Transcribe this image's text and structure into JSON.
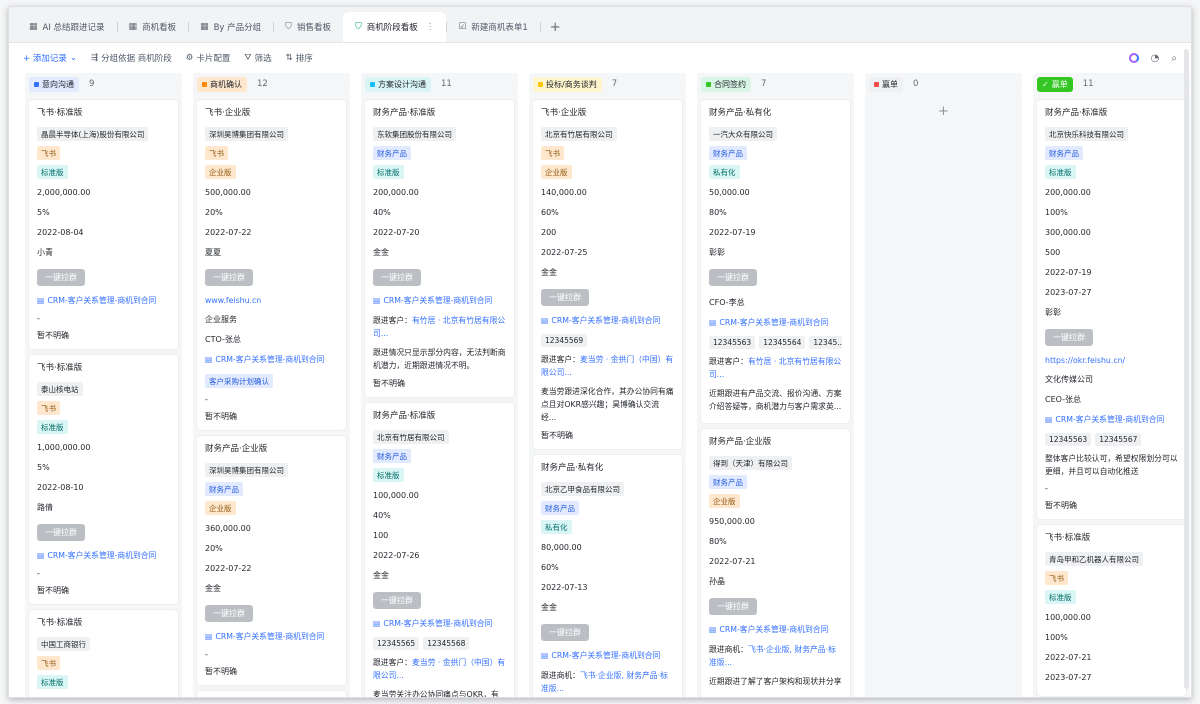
{
  "tabs": [
    {
      "icon": "▦",
      "label": "AI 总结跟进记录"
    },
    {
      "icon": "▦",
      "label": "商机看板"
    },
    {
      "icon": "▦",
      "label": "By 产品分组"
    },
    {
      "icon": "⛉",
      "label": "销售看板"
    },
    {
      "icon": "⛉",
      "label": "商机阶段看板",
      "more": "⋮"
    },
    {
      "icon": "☑",
      "label": "新建商机表单1"
    }
  ],
  "tab_add": "+",
  "toolbar": {
    "add_record": "+ 添加记录",
    "add_caret": "⌄",
    "group_by": "分组依据 商机阶段",
    "card_config": "卡片配置",
    "filter": "筛选",
    "sort": "排序"
  },
  "colors": {
    "accent": "#3370ff",
    "active_tab_icon": "#00a870"
  },
  "columns": [
    {
      "stage": "意向沟通",
      "stage_bg": "#e1eaff",
      "stage_sq": "#3370ff",
      "count": "9",
      "cards": [
        {
          "title": "飞书·标准版",
          "company": "晶晨半导体(上海)股份有限公司",
          "tag1": "飞书",
          "tag2": "标准版",
          "amount": "2,000,000.00",
          "pct": "5%",
          "date": "2022-08-04",
          "owner": "小青",
          "btn": "一键拉群",
          "link": "CRM-客户关系管理-商机到合同",
          "dash": "-",
          "status": "暂不明确"
        },
        {
          "title": "飞书·标准版",
          "company": "泰山核电站",
          "tag1": "飞书",
          "tag2": "标准版",
          "amount": "1,000,000.00",
          "pct": "5%",
          "date": "2022-08-10",
          "owner": "路倩",
          "btn": "一键拉群",
          "link": "CRM-客户关系管理-商机到合同",
          "dash": "-",
          "status": "暂不明确"
        },
        {
          "title": "飞书·标准版",
          "company": "中国工商银行",
          "tag1": "飞书",
          "tag2": "标准版",
          "amount": "1,000,000.00"
        }
      ]
    },
    {
      "stage": "商机确认",
      "stage_bg": "#fee7cd",
      "stage_sq": "#ff8800",
      "count": "12",
      "cards": [
        {
          "title": "飞书·企业版",
          "company": "深圳昊博集团有限公司",
          "tag1": "飞书",
          "tag2": "企业版",
          "amount": "500,000.00",
          "pct": "20%",
          "date": "2022-07-22",
          "owner": "夏夏",
          "btn": "一键拉群",
          "site": "www.feishu.cn",
          "industry": "企业服务",
          "contact": "CTO-张总",
          "link": "CRM-客户关系管理-商机到合同",
          "tag3": "客户采购计划确认",
          "dash": "-",
          "status": "暂不明确"
        },
        {
          "title": "财务产品·企业版",
          "company": "深圳昊博集团有限公司",
          "tag1": "财务产品",
          "tag2": "企业版",
          "amount": "360,000.00",
          "pct": "20%",
          "date": "2022-07-22",
          "owner": "金金",
          "btn": "一键拉群",
          "link": "CRM-客户关系管理-商机到合同",
          "dash": "-",
          "status": "暂不明确"
        },
        {
          "title": "飞书·标准版"
        }
      ]
    },
    {
      "stage": "方案设计沟通",
      "stage_bg": "#d9f5f6",
      "stage_sq": "#14c0ff",
      "count": "11",
      "cards": [
        {
          "title": "财务产品·标准版",
          "company": "东软集团股份有限公司",
          "tag1": "财务产品",
          "tag2": "标准版",
          "amount": "200,000.00",
          "pct": "40%",
          "date": "2022-07-20",
          "owner": "金金",
          "btn": "一键拉群",
          "link": "CRM-客户关系管理-商机到合同",
          "follow_label": "跟进客户：",
          "follow_value": "有竹居 · 北京有竹居有限公司...",
          "note": "跟进情况只显示部分内容，无法判断商机潜力，近期跟进情况不明。",
          "status": "暂不明确"
        },
        {
          "title": "财务产品·标准版",
          "company": "北京有竹居有限公司",
          "tag1": "财务产品",
          "tag2": "标准版",
          "amount": "100,000.00",
          "pct": "40%",
          "num": "100",
          "date": "2022-07-26",
          "owner": "金金",
          "btn": "一键拉群",
          "link": "CRM-客户关系管理-商机到合同",
          "nums": [
            "12345565",
            "12345568"
          ],
          "follow_label": "跟进客户：",
          "follow_value": "麦当劳 · 金拱门（中国）有限公司...",
          "note": "麦当劳关注办公协同痛点与OKR，有飞"
        }
      ]
    },
    {
      "stage": "投标/商务谈判",
      "stage_bg": "#fff5cc",
      "stage_sq": "#ffc60a",
      "count": "7",
      "cards": [
        {
          "title": "飞书·企业版",
          "company": "北京有竹居有限公司",
          "tag1": "飞书",
          "tag2": "企业版",
          "amount": "140,000.00",
          "pct": "60%",
          "num": "200",
          "date": "2022-07-25",
          "owner": "金金",
          "btn": "一键拉群",
          "link": "CRM-客户关系管理-商机到合同",
          "nums": [
            "12345569"
          ],
          "follow_label": "跟进客户：",
          "follow_value": "麦当劳 · 金拱门（中国）有限公司...",
          "note": "麦当劳跟进深化合作，其办公协同有痛点且对OKR感兴趣；昊博确认交流经...",
          "status": "暂不明确"
        },
        {
          "title": "财务产品·私有化",
          "company": "北京乙甲食品有限公司",
          "tag1": "财务产品",
          "tag2": "私有化",
          "amount": "80,000.00",
          "pct": "60%",
          "date": "2022-07-13",
          "owner": "金金",
          "btn": "一键拉群",
          "link": "CRM-客户关系管理-商机到合同",
          "follow_label": "跟进商机：",
          "follow_value": "飞书·企业版, 财务产品·标准版...",
          "note": "跟进情况为与昊博集团沟通交流相关事"
        }
      ]
    },
    {
      "stage": "合同签约",
      "stage_bg": "#d9f5e6",
      "stage_sq": "#34c724",
      "count": "7",
      "cards": [
        {
          "title": "财务产品·私有化",
          "company": "一汽大众有限公司",
          "tag1": "财务产品",
          "tag2": "私有化",
          "amount": "50,000.00",
          "pct": "80%",
          "date": "2022-07-19",
          "owner": "彰彰",
          "btn": "一键拉群",
          "contact": "CFO-李总",
          "link": "CRM-客户关系管理-商机到合同",
          "nums": [
            "12345563",
            "12345564",
            "12345..."
          ],
          "follow_label": "跟进客户：",
          "follow_value": "有竹居 · 北京有竹居有限公司...",
          "note": "近期跟进有产品交流、报价沟通、方案介绍答疑等，商机潜力与客户需求英..."
        },
        {
          "title": "财务产品·企业版",
          "company": "得到（天津）有限公司",
          "tag1": "财务产品",
          "tag2": "企业版",
          "amount": "950,000.00",
          "pct": "80%",
          "date": "2022-07-21",
          "owner": "孙晶",
          "btn": "一键拉群",
          "link": "CRM-客户关系管理-商机到合同",
          "follow_label": "跟进商机：",
          "follow_value": "飞书·企业版, 财务产品·标准版...",
          "note": "近期跟进了解了客户架构和现状并分享"
        }
      ]
    },
    {
      "stage": "赢单",
      "stage_bg": "#eff0f1",
      "stage_sq": "#f54a45",
      "count": "0",
      "add": "+",
      "cards": []
    },
    {
      "stage": "赢单",
      "stage_bg": "#34c724",
      "stage_sq": "#ffffff",
      "stage_fg": "#ffffff",
      "check": "✓",
      "count": "11",
      "cards": [
        {
          "title": "财务产品·标准版",
          "company": "北京快乐科技有限公司",
          "tag1": "财务产品",
          "tag2": "标准版",
          "amount": "200,000.00",
          "pct": "100%",
          "amount2": "300,000.00",
          "num": "500",
          "date": "2022-07-19",
          "date2": "2023-07-27",
          "owner": "彰彰",
          "btn": "一键拉群",
          "site": "https://okr.feishu.cn/",
          "industry": "文化传媒公司",
          "contact": "CEO-张总",
          "link": "CRM-客户关系管理-商机到合同",
          "note": "整体客户比较认可，希望权限划分可以更细，并且可以自动化推送",
          "nums": [
            "12345563",
            "12345567"
          ],
          "dash": "-",
          "status": "暂不明确"
        },
        {
          "title": "飞书·标准版",
          "company": "青岛甲和乙机器人有限公司",
          "tag1": "飞书",
          "tag2": "标准版",
          "amount": "100,000.00",
          "pct": "100%",
          "date": "2022-07-21",
          "date2": "2023-07-27"
        }
      ]
    }
  ]
}
